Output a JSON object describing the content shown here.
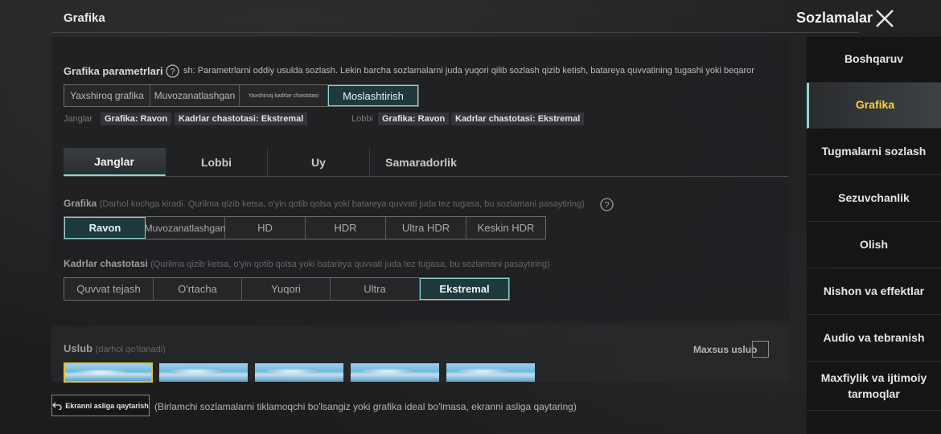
{
  "top": {
    "left_title": "Grafika",
    "right_title": "Sozlamalar"
  },
  "params": {
    "title": "Grafika parametrlari",
    "description": "sh: Parametrlarni oddiy usulda sozlash. Lekin barcha sozlamalarni juda yuqori qilib sozlash qizib ketish, batareya quvvatining tugashi yoki beqaror",
    "presets": [
      "Yaxshiroq grafika",
      "Muvozanatlashgan",
      "Yaxshiroq kadrlar chastotasi",
      "Moslashtirish"
    ],
    "janglar_label": "Janglar",
    "janglar_graphics": "Grafika: Ravon",
    "janglar_fps": "Kadrlar chastotasi: Ekstremal",
    "lobbi_label": "Lobbi",
    "lobbi_graphics": "Grafika: Ravon",
    "lobbi_fps": "Kadrlar chastotasi: Ekstremal"
  },
  "tabs": [
    "Janglar",
    "Lobbi",
    "Uy",
    "Samaradorlik"
  ],
  "graphics": {
    "label": "Grafika",
    "note": "(Darhol kuchga kiradi. Qurilma qizib ketsa, o'yin qotib qolsa yoki batareya quvvati juda tez tugasa, bu sozlamani pasaytiring)",
    "options": [
      "Ravon",
      "Muvozanatlashgan",
      "HD",
      "HDR",
      "Ultra HDR",
      "Keskin HDR"
    ]
  },
  "fps": {
    "label": "Kadrlar chastotasi",
    "note": "(Qurilma qizib ketsa, o'yin qotib qolsa yoki batareya quvvati juda tez tugasa, bu sozlamani pasaytiring)",
    "options": [
      "Quvvat tejash",
      "O'rtacha",
      "Yuqori",
      "Ultra",
      "Ekstremal"
    ]
  },
  "style": {
    "label": "Uslub",
    "note": "(darhol qo'llanadi)",
    "custom_label": "Maxsus uslub"
  },
  "reset": {
    "button_label": "Ekranni asliga qaytarish",
    "description": "(Birlamchi sozlamalarni tiklamoqchi bo'lsangiz yoki grafika ideal bo'lmasa, ekranni asliga qaytaring)"
  },
  "sidebar": {
    "items": [
      "Boshqaruv",
      "Grafika",
      "Tugmalarni sozlash",
      "Sezuvchanlik",
      "Olish",
      "Nishon va effektlar",
      "Audio va tebranish",
      "Maxfiylik va ijtimoiy tarmoqlar"
    ]
  },
  "colors": {
    "accent": "#8fd3cf",
    "active_sidebar_text": "#ffd23f",
    "selected_thumb_border": "#e2c333"
  }
}
